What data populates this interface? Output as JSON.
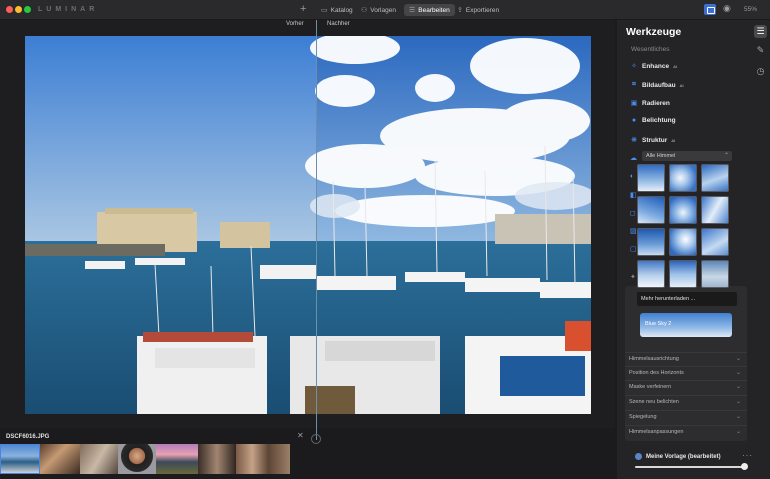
{
  "app": {
    "logo": "LUMINAR",
    "zoom": "55%"
  },
  "nav": [
    {
      "label": "Katalog",
      "glyph": "▭"
    },
    {
      "label": "Vorlagen",
      "glyph": "⚇"
    },
    {
      "label": "Bearbeiten",
      "glyph": "☰"
    },
    {
      "label": "Exportieren",
      "glyph": "⇪"
    }
  ],
  "compare": {
    "before": "Vorher",
    "after": "Nachher"
  },
  "filmstrip": {
    "filename": "DSCF6016.JPG"
  },
  "panel": {
    "title": "Werkzeuge",
    "section": "Wesentliches",
    "tools": [
      {
        "label": "Enhance",
        "sup": "AI",
        "icon": "✧"
      },
      {
        "label": "Bildaufbau",
        "sup": "AI",
        "icon": "⌗"
      },
      {
        "label": "Radieren",
        "sup": "",
        "icon": "▣"
      },
      {
        "label": "Belichtung",
        "sup": "",
        "icon": "●"
      },
      {
        "label": "Struktur",
        "sup": "AI",
        "icon": "❋"
      }
    ],
    "sky_dropdown": "Alle Himmel",
    "tooltip": "Mehr herunterladen ...",
    "sky_preview_label": "Blue Sky 2",
    "accordion": [
      "Himmelsausrichtung",
      "Position des Horizonts",
      "Maske verfeinern",
      "Szene neu belichten",
      "Spiegelung",
      "Himmelsanpassungen"
    ],
    "template": {
      "label": "Meine Vorlage (bearbeitet)",
      "more": "···",
      "slider_value": 0.98
    }
  }
}
